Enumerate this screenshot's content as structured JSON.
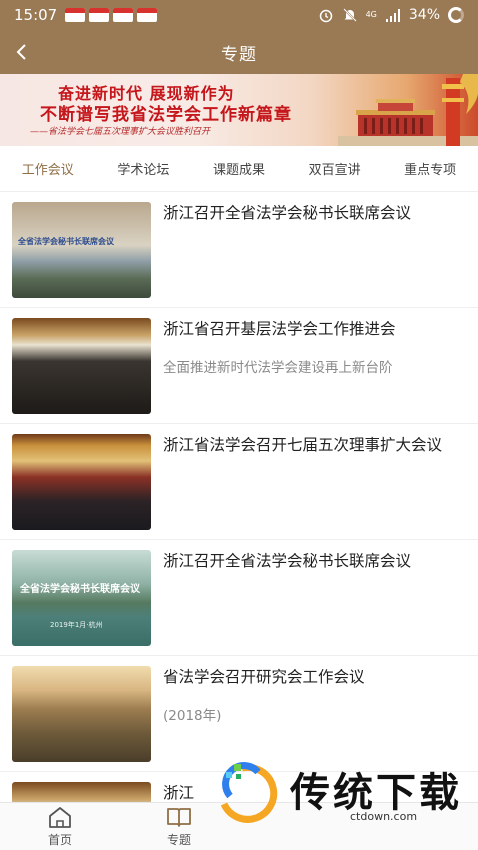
{
  "status_bar": {
    "time": "15:07",
    "notification_icons": [
      "app-notification-icon",
      "app-notification-icon",
      "app-notification-icon",
      "app-notification-icon"
    ],
    "network": "4G",
    "battery": "34%"
  },
  "header": {
    "title": "专题"
  },
  "banner": {
    "line1": "奋进新时代  展现新作为",
    "line2": "不断谱写我省法学会工作新篇章",
    "subtitle": "——省法学会七届五次理事扩大会议胜利召开"
  },
  "tabs": [
    {
      "label": "工作会议"
    },
    {
      "label": "学术论坛"
    },
    {
      "label": "课题成果"
    },
    {
      "label": "双百宣讲"
    },
    {
      "label": "重点专项"
    }
  ],
  "articles": [
    {
      "title": "浙江召开全省法学会秘书长联席会议",
      "subtitle": "",
      "thumb_caption": "全省法学会秘书长联席会议"
    },
    {
      "title": "浙江省召开基层法学会工作推进会",
      "subtitle": "全面推进新时代法学会建设再上新台阶",
      "thumb_caption": ""
    },
    {
      "title": "浙江省法学会召开七届五次理事扩大会议",
      "subtitle": "",
      "thumb_caption": ""
    },
    {
      "title": "浙江召开全省法学会秘书长联席会议",
      "subtitle": "",
      "thumb_caption": "全省法学会秘书长联席会议",
      "thumb_date": "2019年1月·杭州"
    },
    {
      "title": "省法学会召开研究会工作会议",
      "subtitle": "(2018年)",
      "thumb_caption": ""
    },
    {
      "title": "浙江",
      "subtitle": "",
      "thumb_caption": ""
    }
  ],
  "bottom_nav": [
    {
      "label": "首页",
      "icon": "home-icon"
    },
    {
      "label": "专题",
      "icon": "book-icon"
    }
  ],
  "watermark": {
    "text": "传统下载",
    "url": "ctdown.com"
  },
  "colors": {
    "primary": "#9a7a55",
    "banner_red": "#c5161b",
    "tab_active": "#8f6e45"
  }
}
